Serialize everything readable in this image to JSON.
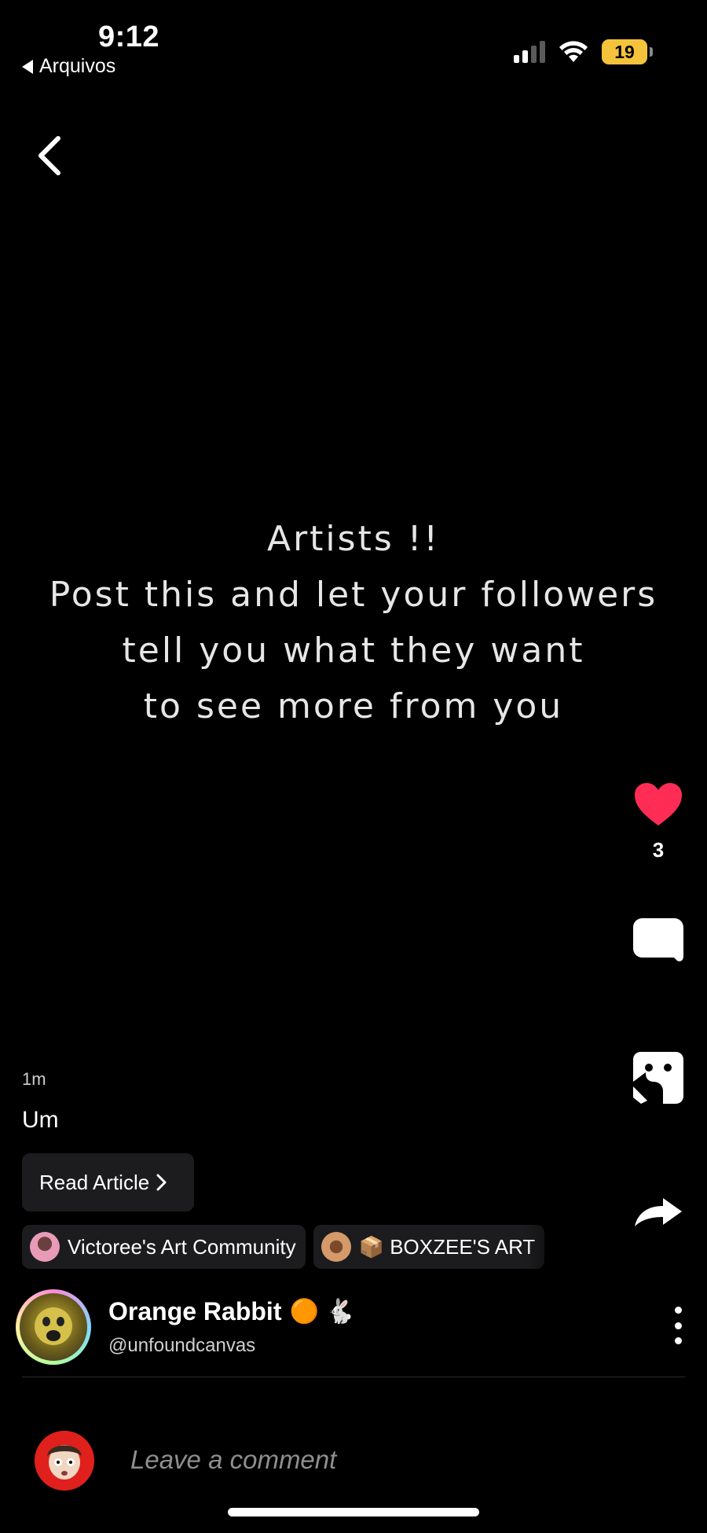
{
  "status_bar": {
    "time": "9:12",
    "back_app": "Arquivos",
    "battery": "19"
  },
  "post": {
    "art_text": [
      "Artists !!",
      "Post this and let your followers",
      "tell you what they want",
      "to see more from you"
    ],
    "timestamp": "1m",
    "title": "Um",
    "read_article_label": "Read Article",
    "likes": "3"
  },
  "communities": [
    {
      "name": "Victoree's Art Community"
    },
    {
      "name": "📦 BOXZEE'S ART"
    }
  ],
  "author": {
    "name": "Orange Rabbit",
    "name_emojis": "🟠 🐇",
    "handle": "@unfoundcanvas"
  },
  "comment": {
    "placeholder": "Leave a comment"
  },
  "icons": [
    "back-chevron-icon",
    "heart-icon",
    "comment-icon",
    "remix-icon",
    "share-icon",
    "more-icon"
  ],
  "colors": {
    "like": "#ff2d55",
    "battery": "#f5c33b"
  }
}
